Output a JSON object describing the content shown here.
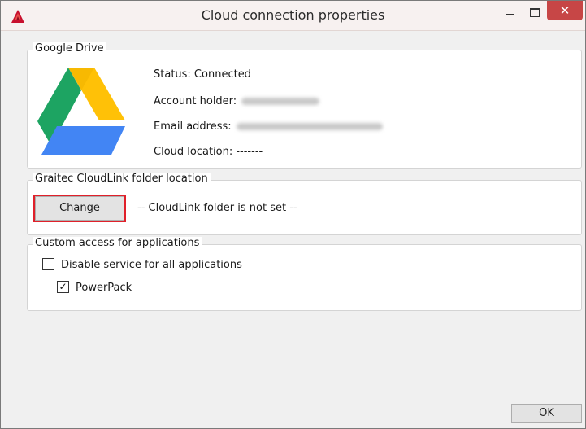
{
  "window": {
    "title": "Cloud connection properties",
    "accent_close": "#c74646",
    "highlight_color": "#e0202a"
  },
  "google_drive": {
    "group_label": "Google Drive",
    "logo": "google-drive-logo",
    "status": "Status: Connected",
    "account_holder_label": "Account holder:",
    "email_label": "Email address:",
    "cloud_location": "Cloud location: -------"
  },
  "cloudlink": {
    "group_label": "Graitec CloudLink folder location",
    "change_label": "Change",
    "folder_status": "-- CloudLink folder is not set --"
  },
  "custom_access": {
    "group_label": "Custom access for applications",
    "disable_all_label": "Disable service for all applications",
    "disable_all_checked": false,
    "powerpack_label": "PowerPack",
    "powerpack_checked": true
  },
  "footer": {
    "ok_label": "OK"
  }
}
